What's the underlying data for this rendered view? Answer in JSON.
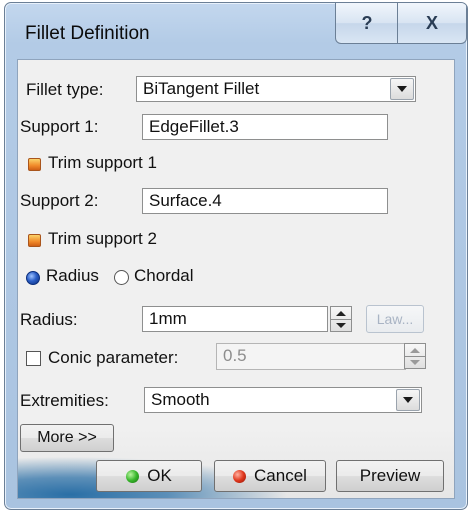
{
  "window": {
    "title": "Fillet Definition",
    "help_label": "?",
    "close_label": "X"
  },
  "fillet_type": {
    "label": "Fillet type:",
    "selected": "BiTangent Fillet"
  },
  "support1": {
    "label": "Support 1:",
    "value": "EdgeFillet.3",
    "trim_label": "Trim support 1",
    "trim_checked": true
  },
  "support2": {
    "label": "Support 2:",
    "value": "Surface.4",
    "trim_label": "Trim support 2",
    "trim_checked": true
  },
  "section_mode": {
    "radius_label": "Radius",
    "chordal_label": "Chordal",
    "selected": "Radius"
  },
  "radius": {
    "label": "Radius:",
    "value": "1mm",
    "law_label": "Law..."
  },
  "conic": {
    "label": "Conic parameter:",
    "value": "0.5",
    "checked": false
  },
  "extremities": {
    "label": "Extremities:",
    "selected": "Smooth"
  },
  "buttons": {
    "more": "More >>",
    "ok": "OK",
    "cancel": "Cancel",
    "preview": "Preview"
  },
  "colors": {
    "title_bar": "#b3cbe6",
    "dialog_bg": "#f0f0f0",
    "trim_check": "#f08a2a",
    "radio_selected": "#2c5fc7",
    "ok_icon": "#38b62c",
    "cancel_icon": "#e0371d"
  }
}
